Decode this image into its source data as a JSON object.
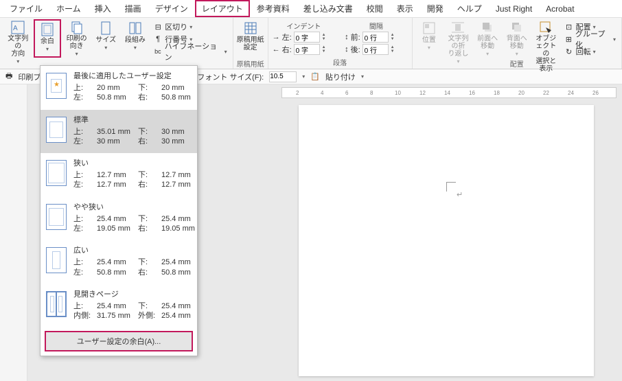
{
  "menubar": {
    "tabs": [
      "ファイル",
      "ホーム",
      "挿入",
      "描画",
      "デザイン",
      "レイアウト",
      "参考資料",
      "差し込み文書",
      "校閲",
      "表示",
      "開発",
      "ヘルプ",
      "Just Right",
      "Acrobat"
    ],
    "active_index": 5
  },
  "ribbon": {
    "page_setup": {
      "text_direction": "文字列の\n方向",
      "margins": "余白",
      "orientation": "印刷の\n向き",
      "size": "サイズ",
      "columns": "段組み"
    },
    "breaks": "区切り",
    "line_numbers": "行番号",
    "hyphenation": "ハイフネーション",
    "manuscript": "原稿用紙\n設定",
    "manuscript_group": "原稿用紙",
    "indent_group": "段落",
    "indent_head": "インデント",
    "spacing_head": "間隔",
    "indent_left_label": "左:",
    "indent_right_label": "右:",
    "indent_left": "0 字",
    "indent_right": "0 字",
    "spacing_before_label": "前:",
    "spacing_after_label": "後:",
    "spacing_before": "0 行",
    "spacing_after": "0 行",
    "arrange_group": "配置",
    "position": "位置",
    "wrap": "文字列の折\nり返し",
    "bring_forward": "前面へ\n移動",
    "send_backward": "背面へ\n移動",
    "selection_pane": "オブジェクトの\n選択と表示",
    "align": "配置",
    "group": "グループ化",
    "rotate": "回転"
  },
  "secondary": {
    "print_preview": "印刷プ",
    "font_size_label": "フォント サイズ(F):",
    "font_size": "10.5",
    "paste": "貼り付け"
  },
  "ruler_ticks": [
    "2",
    "4",
    "6",
    "8",
    "10",
    "12",
    "14",
    "16",
    "18",
    "20",
    "22",
    "24",
    "26"
  ],
  "dropdown": {
    "items": [
      {
        "title": "最後に適用したユーザー設定",
        "top": "20 mm",
        "bottom": "20 mm",
        "left": "50.8 mm",
        "right": "50.8 mm",
        "thumb": "th-last"
      },
      {
        "title": "標準",
        "top": "35.01 mm",
        "bottom": "30 mm",
        "left": "30 mm",
        "right": "30 mm",
        "thumb": "th-std"
      },
      {
        "title": "狭い",
        "top": "12.7 mm",
        "bottom": "12.7 mm",
        "left": "12.7 mm",
        "right": "12.7 mm",
        "thumb": "th-narrow"
      },
      {
        "title": "やや狭い",
        "top": "25.4 mm",
        "bottom": "25.4 mm",
        "left": "19.05 mm",
        "right": "19.05 mm",
        "thumb": "th-med"
      },
      {
        "title": "広い",
        "top": "25.4 mm",
        "bottom": "25.4 mm",
        "left": "50.8 mm",
        "right": "50.8 mm",
        "thumb": "th-wide"
      },
      {
        "title": "見開きページ",
        "top": "25.4 mm",
        "bottom": "25.4 mm",
        "left_label": "内側:",
        "left": "31.75 mm",
        "right_label": "外側:",
        "right": "25.4 mm",
        "thumb": "th-mirror"
      }
    ],
    "top_label": "上:",
    "bottom_label": "下:",
    "left_label": "左:",
    "right_label": "右:",
    "custom": "ユーザー設定の余白(A)...",
    "selected_index": 1
  },
  "page_mark": "↵"
}
